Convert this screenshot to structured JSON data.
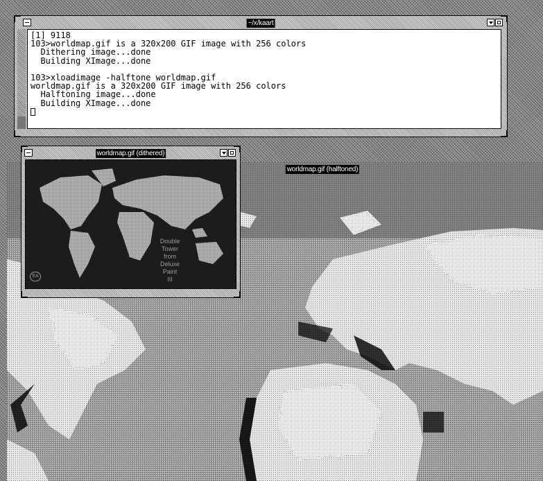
{
  "terminal": {
    "title": "~/x/kaart",
    "lines": [
      "[1] 9118",
      "103>worldmap.gif is a 320x200 GIF image with 256 colors",
      "  Dithering image...done",
      "  Building XImage...done",
      "",
      "103>xloadimage -halftone worldmap.gif",
      "worldmap.gif is a 320x200 GIF image with 256 colors",
      "  Halftoning image...done",
      "  Building XImage...done"
    ]
  },
  "dithered_window": {
    "title": "worldmap.gif (dithered)",
    "map_caption": [
      "Double",
      "Tower",
      "from",
      "Deluxe",
      "Paint",
      "III"
    ],
    "logo": "EA"
  },
  "halftoned_window": {
    "title": "worldmap.gif (halftoned)"
  },
  "colors": {
    "desktop": "#8c8c8c",
    "frame": "#b8b8b8",
    "title_bg": "#000000",
    "title_fg": "#ffffff",
    "terminal_bg": "#ffffff"
  }
}
